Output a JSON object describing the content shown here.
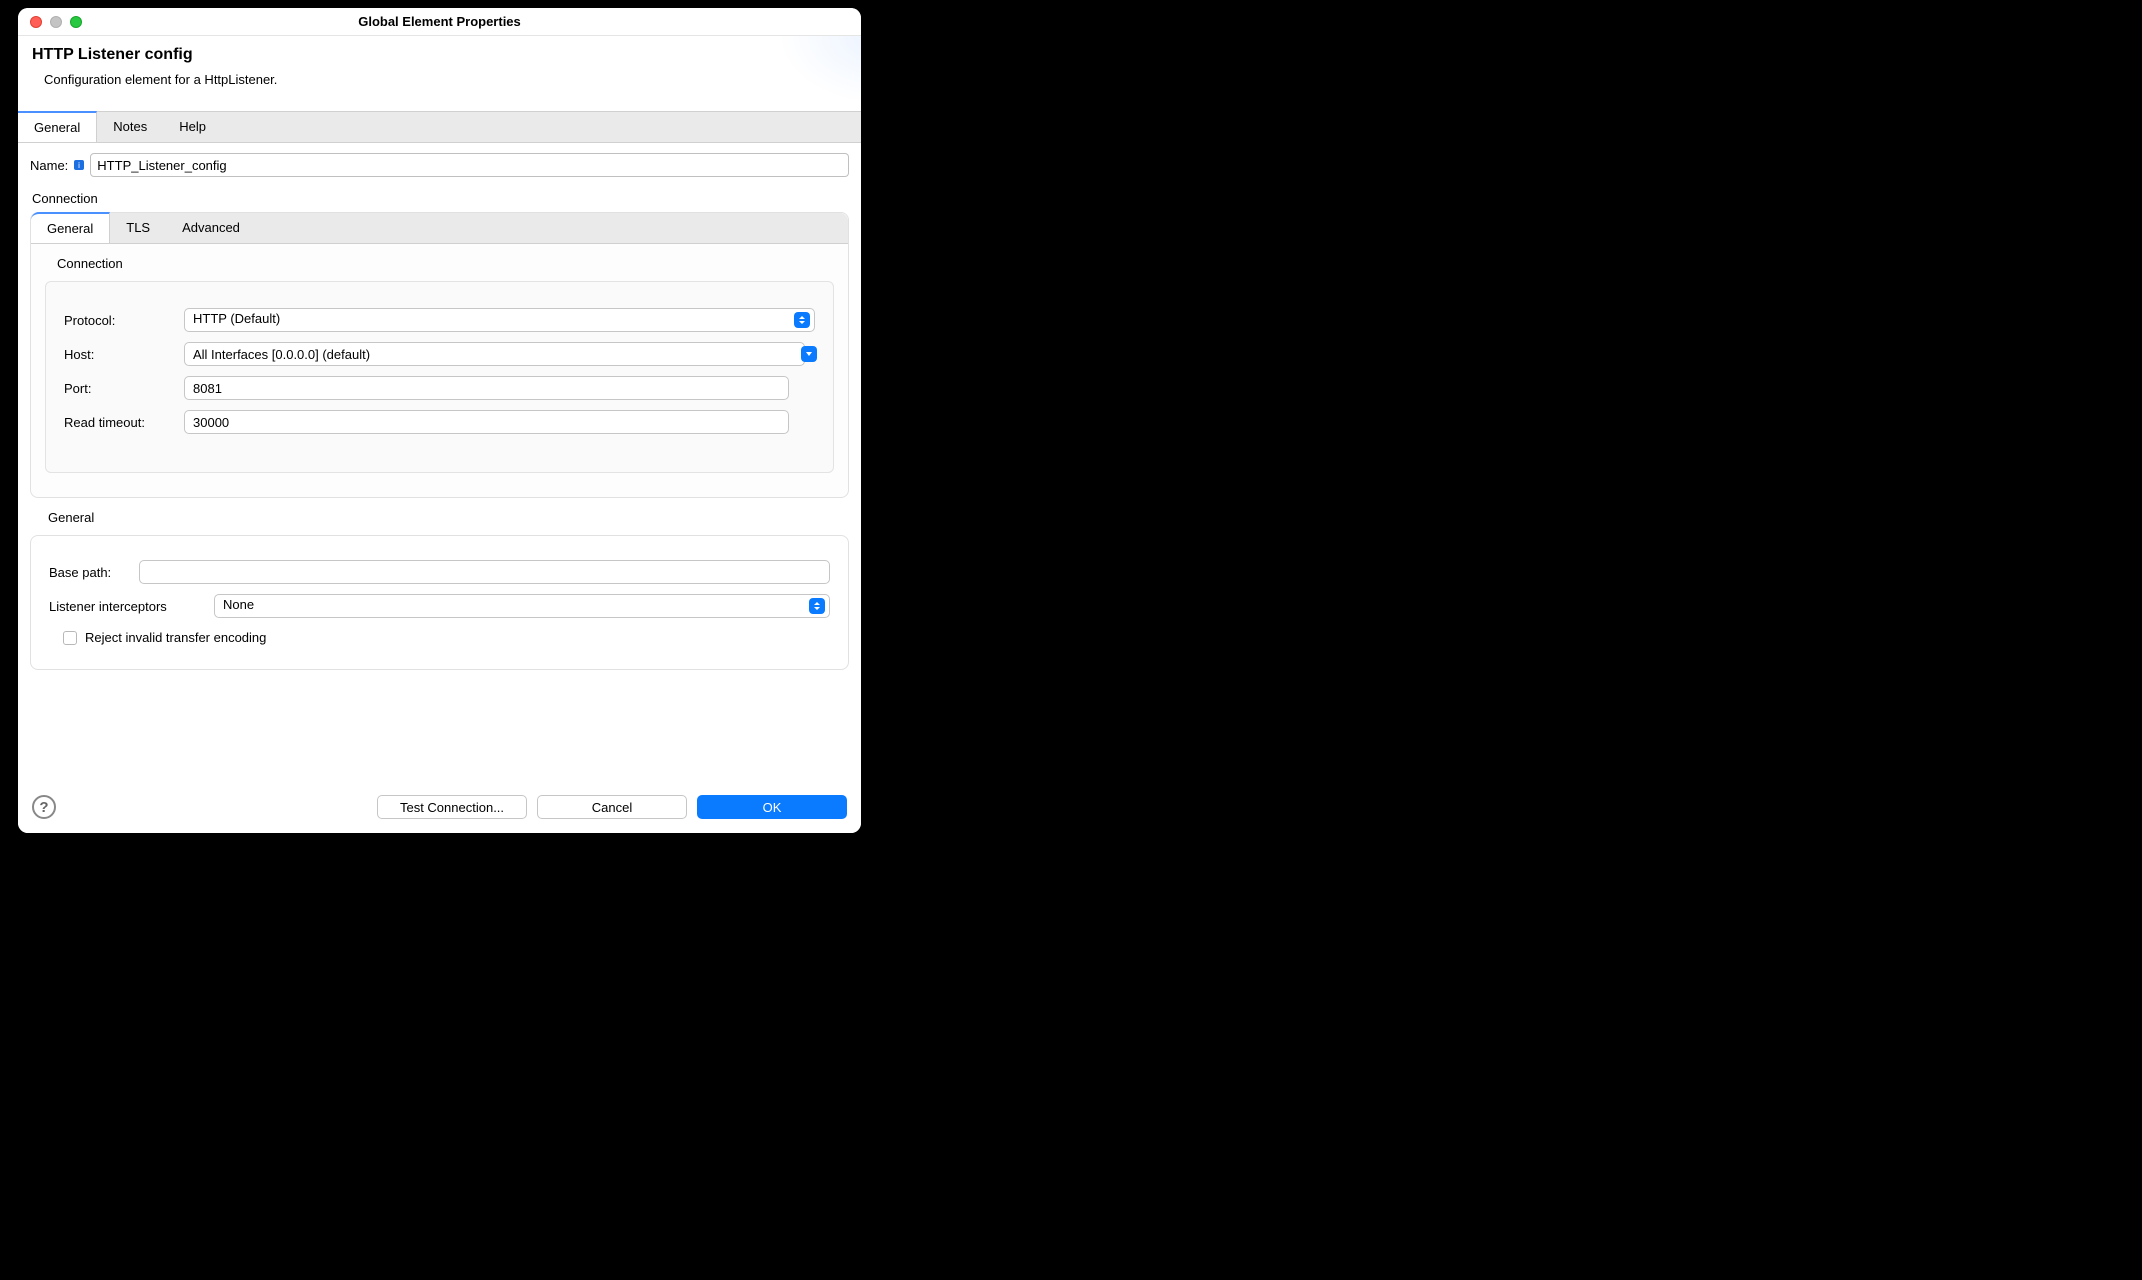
{
  "window": {
    "title": "Global Element Properties"
  },
  "header": {
    "title": "HTTP Listener config",
    "description": "Configuration element for a HttpListener."
  },
  "tabs": {
    "items": [
      "General",
      "Notes",
      "Help"
    ],
    "active": 0
  },
  "form": {
    "name_label": "Name:",
    "name_value": "HTTP_Listener_config",
    "connection_label": "Connection",
    "inner_tabs": [
      "General",
      "TLS",
      "Advanced"
    ],
    "inner_active": 0,
    "connection_section_label": "Connection",
    "protocol_label": "Protocol:",
    "protocol_value": "HTTP (Default)",
    "host_label": "Host:",
    "host_value": "All Interfaces [0.0.0.0] (default)",
    "port_label": "Port:",
    "port_value": "8081",
    "read_timeout_label": "Read timeout:",
    "read_timeout_value": "30000",
    "general_section_label": "General",
    "base_path_label": "Base path:",
    "base_path_value": "",
    "listener_interceptors_label": "Listener interceptors",
    "listener_interceptors_value": "None",
    "reject_invalid_label": "Reject invalid transfer encoding"
  },
  "footer": {
    "test_connection": "Test Connection...",
    "cancel": "Cancel",
    "ok": "OK"
  }
}
